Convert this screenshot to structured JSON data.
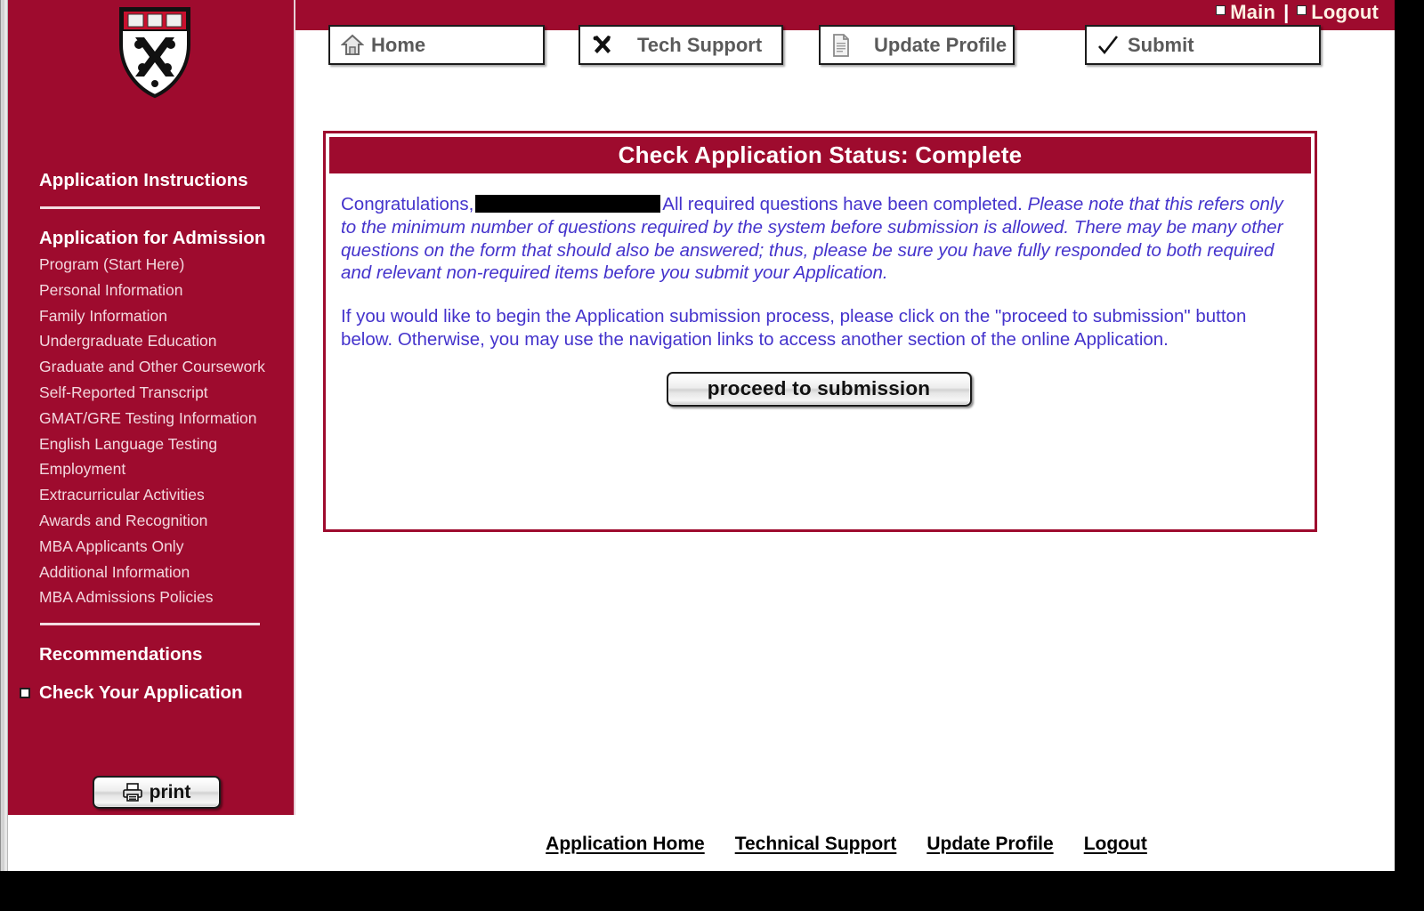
{
  "topbar": {
    "links": [
      {
        "label": "Main",
        "icon": "square-bullet-icon"
      },
      {
        "label": "Logout",
        "icon": "square-bullet-icon"
      }
    ],
    "separator": "|"
  },
  "nav_buttons": [
    {
      "label": "Home",
      "icon": "house-icon"
    },
    {
      "label": "Tech Support",
      "icon": "tools-icon"
    },
    {
      "label": "Update Profile",
      "icon": "document-icon"
    },
    {
      "label": "Submit",
      "icon": "checkmark-icon"
    }
  ],
  "sidebar": {
    "logo_alt": "harvard-business-school-shield",
    "instructions_heading": "Application Instructions",
    "admission_heading": "Application for Admission",
    "links": [
      "Program (Start Here)",
      "Personal Information",
      "Family Information",
      "Undergraduate Education",
      "Graduate and Other Coursework",
      "Self-Reported Transcript",
      "GMAT/GRE Testing Information",
      "English Language Testing",
      "Employment",
      "Extracurricular Activities",
      "Awards and Recognition",
      "MBA Applicants Only",
      "Additional Information",
      "MBA Admissions Policies"
    ],
    "recommendations_heading": "Recommendations",
    "current_page": "Check Your Application",
    "print_button": {
      "label": "print",
      "icon": "printer-icon"
    }
  },
  "panel": {
    "title": "Check Application Status: Complete",
    "paragraph1_before": "Congratulations,",
    "redacted_name": "",
    "paragraph1_after": "All required questions have been completed.",
    "paragraph1_italic": "Please note that this refers only to the minimum number of questions required by the system before submission is allowed. There may be many other questions on the form that should also be answered; thus, please be sure you have fully responded to both required and relevant non-required items before you submit your Application.",
    "paragraph2": "If you would like to begin the Application submission process, please click on the \"proceed to submission\" button below. Otherwise, you may use the navigation links to access another section of the online Application.",
    "proceed_button": "proceed to submission"
  },
  "footer": {
    "links": [
      "Application Home",
      "Technical Support",
      "Update Profile",
      "Logout"
    ]
  },
  "colors": {
    "brand_maroon": "#9e0b2e",
    "body_text_blue": "#4433cc",
    "sidebar_link": "#f2d7de",
    "page_background": "#ffffff"
  }
}
